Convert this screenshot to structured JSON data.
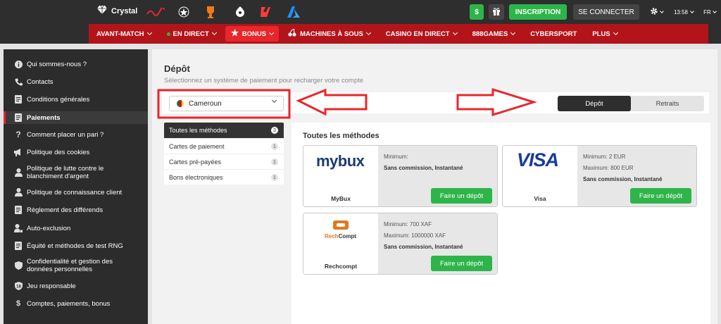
{
  "topbar": {
    "brand": "Crystal",
    "inscription": "INSCRIPTION",
    "connect": "SE CONNECTER",
    "time": "13:58",
    "lang": "FR",
    "dollar": "$"
  },
  "nav": {
    "items": [
      "AVANT-MATCH",
      "EN DIRECT",
      "BONUS",
      "MACHINES À SOUS",
      "CASINO EN DIRECT",
      "888GAMES",
      "CYBERSPORT",
      "PLUS"
    ]
  },
  "sidebar": {
    "items": [
      "Qui sommes-nous ?",
      "Contacts",
      "Conditions générales",
      "Paiements",
      "Comment placer un pari ?",
      "Politique des cookies",
      "Politique de lutte contre le blanchiment d'argent",
      "Politique de connaissance client",
      "Règlement des différends",
      "Auto-exclusion",
      "Équité et méthodes de test RNG",
      "Confidentialité et gestion des données personnelles",
      "Jeu responsable",
      "Comptes, paiements, bonus"
    ]
  },
  "main": {
    "title": "Dépôt",
    "subtitle": "Sélectionnez un système de paiement pour recharger votre compte",
    "country": "Cameroun",
    "tab_deposit": "Dépôt",
    "tab_withdraw": "Retraits",
    "panel_title": "Toutes les méthodes"
  },
  "methods": [
    {
      "label": "Toutes les méthodes",
      "count": "3"
    },
    {
      "label": "Cartes de paiement",
      "count": "1"
    },
    {
      "label": "Cartes pré-payées",
      "count": "1"
    },
    {
      "label": "Bons électroniques",
      "count": "1"
    }
  ],
  "cards": {
    "mybux": {
      "logo": "mybux",
      "name": "MyBux",
      "min": "Minimum:",
      "fee": "Sans commission, Instantané",
      "button": "Faire un dépôt"
    },
    "visa": {
      "logo": "VISA",
      "name": "Visa",
      "min": "Minimum: 2 EUR",
      "max": "Maximum: 800 EUR",
      "fee": "Sans commission, Instantané",
      "button": "Faire un dépôt"
    },
    "rechcompt": {
      "logo_a": "Rech",
      "logo_b": "Compt",
      "name": "Rechcompt",
      "min": "Minimum: 700 XAF",
      "max": "Maximum: 1000000 XAF",
      "fee": "Sans commission, Instantané",
      "button": "Faire un dépôt"
    }
  },
  "colors": {
    "accent_red": "#e8262b",
    "nav_red": "#b3141a",
    "green": "#2db54a",
    "dark": "#2e2e2e"
  }
}
